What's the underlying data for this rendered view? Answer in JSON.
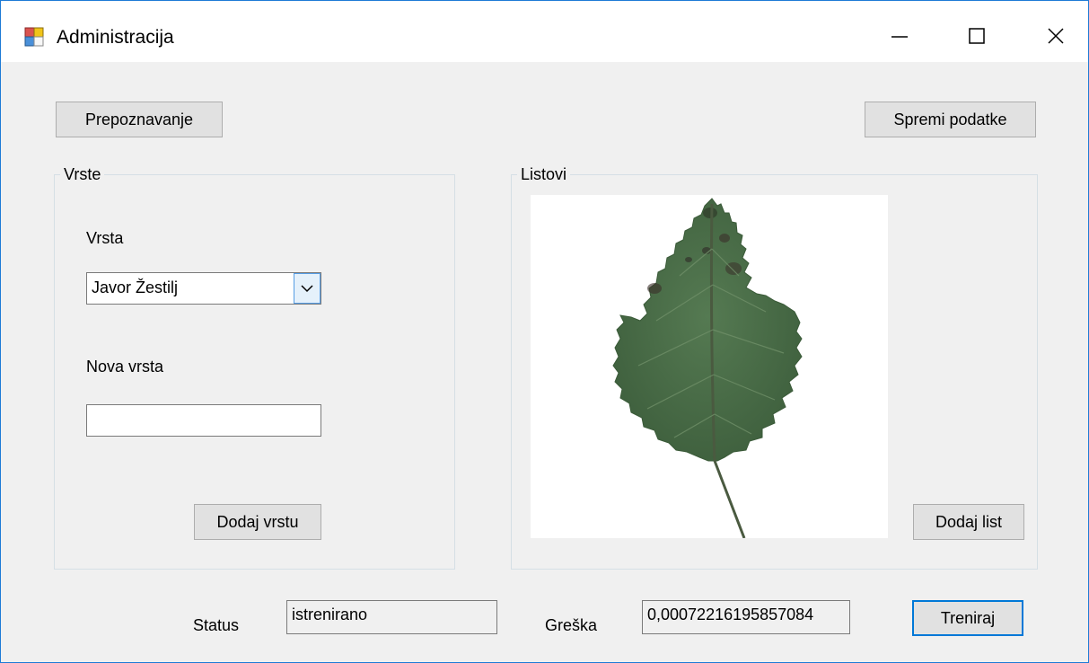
{
  "window": {
    "title": "Administracija",
    "icon": "winforms-app-icon",
    "controls": [
      "minimize-icon",
      "maximize-icon",
      "close-icon"
    ]
  },
  "toolbar": {
    "recognize_label": "Prepoznavanje",
    "save_label": "Spremi podatke"
  },
  "species_group": {
    "legend": "Vrste",
    "species_label": "Vrsta",
    "species_selected": "Javor Žestilj",
    "new_species_label": "Nova vrsta",
    "new_species_value": "",
    "add_species_label": "Dodaj vrstu"
  },
  "leaves_group": {
    "legend": "Listovi",
    "add_leaf_label": "Dodaj list",
    "image": "maple-leaf-scan"
  },
  "footer": {
    "status_label": "Status",
    "status_value": "istrenirano",
    "error_label": "Greška",
    "error_value": "0,00072216195857084",
    "train_label": "Treniraj"
  },
  "colors": {
    "accent": "#0078d7",
    "window_border": "#1e7bd6",
    "leaf": "#4a6a48"
  }
}
